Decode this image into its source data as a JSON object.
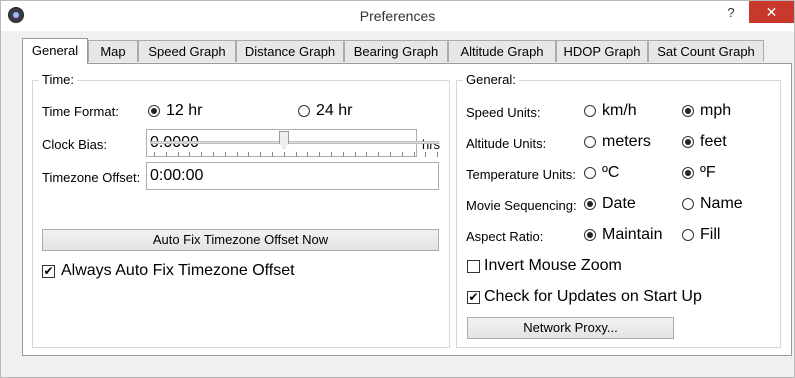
{
  "window": {
    "title": "Preferences",
    "help_label": "?",
    "close_label": "✕"
  },
  "tabs": [
    "General",
    "Map",
    "Speed Graph",
    "Distance Graph",
    "Bearing Graph",
    "Altitude Graph",
    "HDOP Graph",
    "Sat Count Graph"
  ],
  "time": {
    "title": "Time:",
    "time_format_label": "Time Format:",
    "opt_12": "12 hr",
    "opt_24": "24 hr",
    "clock_bias_label": "Clock Bias:",
    "clock_bias_value": "0.0000",
    "clock_bias_unit": "hrs",
    "tz_offset_label": "Timezone Offset:",
    "tz_offset_value": "0:00:00",
    "auto_fix_button": "Auto Fix Timezone Offset Now",
    "always_auto_fix": "Always Auto Fix Timezone Offset"
  },
  "general": {
    "title": "General:",
    "speed_label": "Speed Units:",
    "speed_opt1": "km/h",
    "speed_opt2": "mph",
    "altitude_label": "Altitude Units:",
    "altitude_opt1": "meters",
    "altitude_opt2": "feet",
    "temp_label": "Temperature Units:",
    "temp_opt1": "ºC",
    "temp_opt2": "ºF",
    "movie_label": "Movie Sequencing:",
    "movie_opt1": "Date",
    "movie_opt2": "Name",
    "aspect_label": "Aspect Ratio:",
    "aspect_opt1": "Maintain",
    "aspect_opt2": "Fill",
    "invert_mouse": "Invert Mouse Zoom",
    "check_updates": "Check for Updates on Start Up",
    "network_button": "Network Proxy..."
  }
}
